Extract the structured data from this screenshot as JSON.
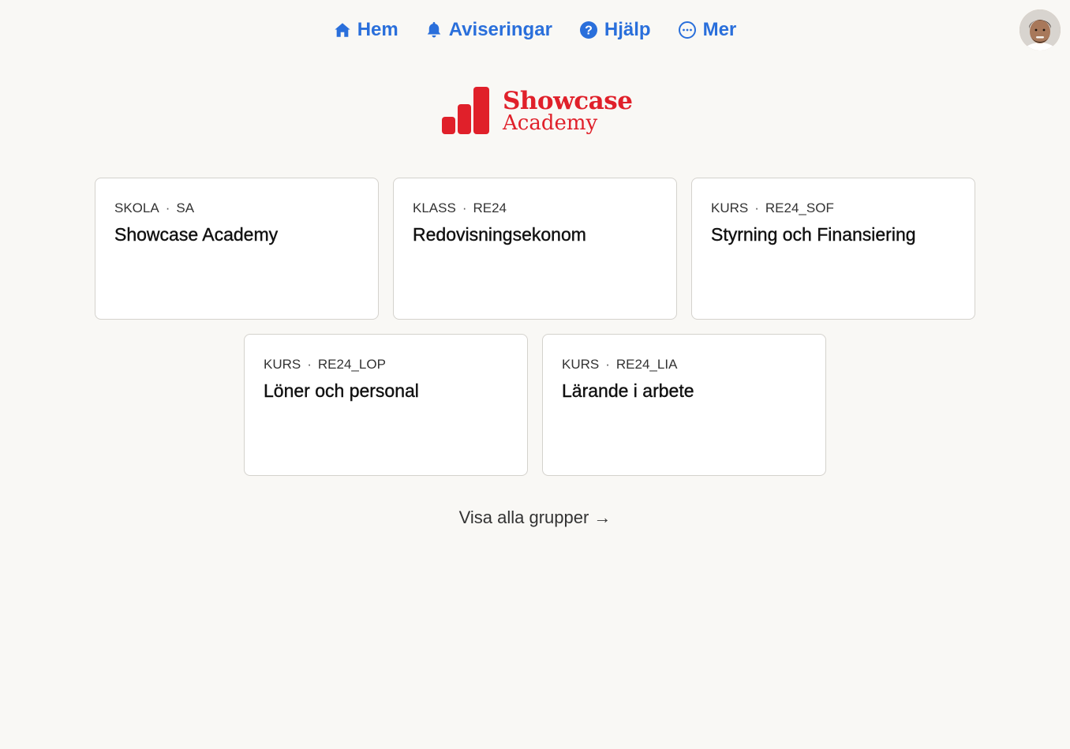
{
  "nav": {
    "items": [
      {
        "label": "Hem",
        "icon": "home-icon"
      },
      {
        "label": "Aviseringar",
        "icon": "bell-icon"
      },
      {
        "label": "Hjälp",
        "icon": "help-icon"
      },
      {
        "label": "Mer",
        "icon": "more-icon"
      }
    ],
    "accent_color": "#2a6fdb"
  },
  "user": {
    "avatar": "user-avatar"
  },
  "logo": {
    "title": "Showcase",
    "subtitle": "Academy",
    "color": "#e0202a"
  },
  "groups": [
    {
      "type": "SKOLA",
      "code": "SA",
      "name": "Showcase Academy"
    },
    {
      "type": "KLASS",
      "code": "RE24",
      "name": "Redovisningsekonom"
    },
    {
      "type": "KURS",
      "code": "RE24_SOF",
      "name": "Styrning och Finansiering"
    },
    {
      "type": "KURS",
      "code": "RE24_LOP",
      "name": "Löner och personal"
    },
    {
      "type": "KURS",
      "code": "RE24_LIA",
      "name": "Lärande i arbete"
    }
  ],
  "show_all": {
    "label": "Visa alla grupper →"
  },
  "separator": "·"
}
